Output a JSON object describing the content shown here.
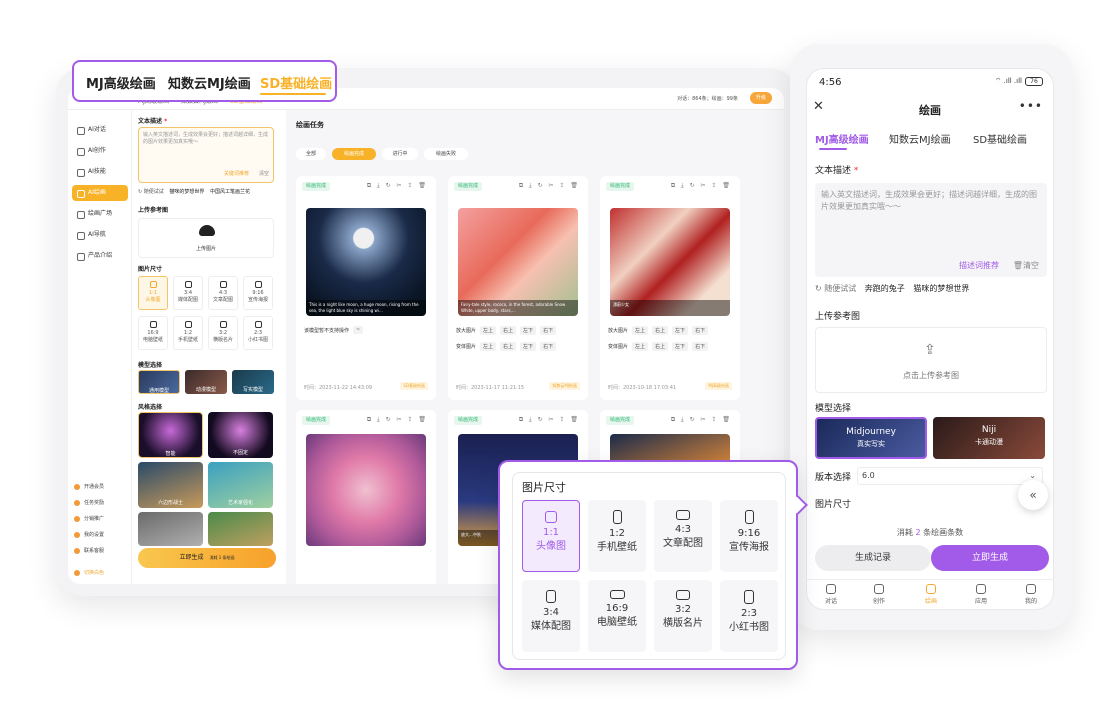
{
  "app_tabs": [
    "MJ高级绘画",
    "知数云MJ绘画",
    "SD基础绘画"
  ],
  "desktop": {
    "top_meta": "对话：864条；绘画：99条",
    "vip": "升级",
    "sidebar": [
      "AI对话",
      "AI创作",
      "AI技能",
      "AI绘画",
      "绘画广场",
      "AI导航",
      "产品介绍"
    ],
    "sidebar_bottom": [
      "开通会员",
      "任务奖励",
      "分销推广",
      "我的设置",
      "联系客服",
      "切换白色"
    ],
    "form": {
      "text_label": "文本描述",
      "placeholder": "输入英文描述词，生成效果会更好；描述词越详细，生成的图片效果更加真实哦～",
      "desc_link": "关键词推荐",
      "clear": "清空",
      "suggest_prefix": "随便试试",
      "suggest_items": [
        "猫咪的梦想世界",
        "中国风工笔画兰花"
      ],
      "upload_label": "上传参考图",
      "upload_text": "上传图片",
      "size_label": "图片尺寸",
      "sizes": [
        {
          "r": "1:1",
          "n": "头像图"
        },
        {
          "r": "3:4",
          "n": "媒体配图"
        },
        {
          "r": "4:3",
          "n": "文章配图"
        },
        {
          "r": "9:16",
          "n": "宣传海报"
        },
        {
          "r": "16:9",
          "n": "电脑壁纸"
        },
        {
          "r": "1:2",
          "n": "手机壁纸"
        },
        {
          "r": "3:2",
          "n": "横版名片"
        },
        {
          "r": "2:3",
          "n": "小红书图"
        }
      ],
      "model_label": "模型选择",
      "models": [
        "通用模型",
        "动漫模型",
        "写实模型"
      ],
      "style_label": "风格选择",
      "styles": [
        "智能",
        "不固定",
        "六边形战士",
        "艺术家强化"
      ],
      "gen_btn": "立即生成",
      "gen_cost": "消耗 1 条绘画"
    },
    "tasks": {
      "title": "绘画任务",
      "filters": [
        "全部",
        "绘画完成",
        "进行中",
        "绘画失败"
      ],
      "status": "绘画完成",
      "tools": "⧉ ⤓ ↻ ✂ ⇪ 🗑",
      "cards": [
        {
          "caption": "This is a night like moon, a huge moon, rising from the sea, the light blue sky is shining wi…",
          "note": "该模型暂不支持操作",
          "time": "时间：2023-11-22 14:43:09",
          "tag": "SD基础绘画"
        },
        {
          "caption": "Fairy-tale style, rococo, in the forest, adorable Snow White, upper body, stars,…",
          "time": "时间：2023-11-17 11:21:15",
          "tag": "知数云MJ绘画"
        },
        {
          "caption": "漂蔚少女",
          "time": "时间：2023-10-18 17:03:41",
          "tag": "MJ高级绘画"
        },
        {
          "caption": ""
        },
        {
          "caption": "放大…中秋"
        },
        {
          "caption": ""
        }
      ],
      "zoom_label": "放大图片",
      "var_label": "变体图片",
      "pos": [
        "左上",
        "右上",
        "左下",
        "右下"
      ]
    }
  },
  "phone": {
    "time": "4:56",
    "signal": "⌔ .ıll .ıll",
    "battery": "76",
    "title": "绘画",
    "tabs": [
      "MJ高级绘画",
      "知数云MJ绘画",
      "SD基础绘画"
    ],
    "text_label": "文本描述",
    "placeholder": "输入英文描述词，生成效果会更好；描述词越详细，生成的图片效果更加真实哦～～",
    "desc_link": "描述词推荐",
    "clear": "清空",
    "suggest_prefix": "随便试试",
    "suggest_items": [
      "奔跑的兔子",
      "猫咪的梦想世界"
    ],
    "upload_label": "上传参考图",
    "upload_text": "点击上传参考图",
    "model_label": "模型选择",
    "models": [
      {
        "n": "Midjourney",
        "s": "真实写实"
      },
      {
        "n": "Niji",
        "s": "卡通动漫"
      }
    ],
    "version_label": "版本选择",
    "version": "6.0",
    "size_label": "图片尺寸",
    "cost_pre": "消耗",
    "cost_num": "2",
    "cost_post": "条绘画条数",
    "record_btn": "生成记录",
    "go_btn": "立即生成",
    "nav": [
      "对话",
      "创作",
      "绘画",
      "应用",
      "我的"
    ]
  },
  "popup": {
    "title": "图片尺寸",
    "sizes": [
      {
        "r": "1:1",
        "n": "头像图"
      },
      {
        "r": "1:2",
        "n": "手机壁纸"
      },
      {
        "r": "4:3",
        "n": "文章配图"
      },
      {
        "r": "9:16",
        "n": "宣传海报"
      },
      {
        "r": "3:4",
        "n": "媒体配图"
      },
      {
        "r": "16:9",
        "n": "电脑壁纸"
      },
      {
        "r": "3:2",
        "n": "横版名片"
      },
      {
        "r": "2:3",
        "n": "小红书图"
      }
    ]
  },
  "colors": {
    "accent_orange": "#f7b227",
    "accent_purple": "#a15be8"
  }
}
